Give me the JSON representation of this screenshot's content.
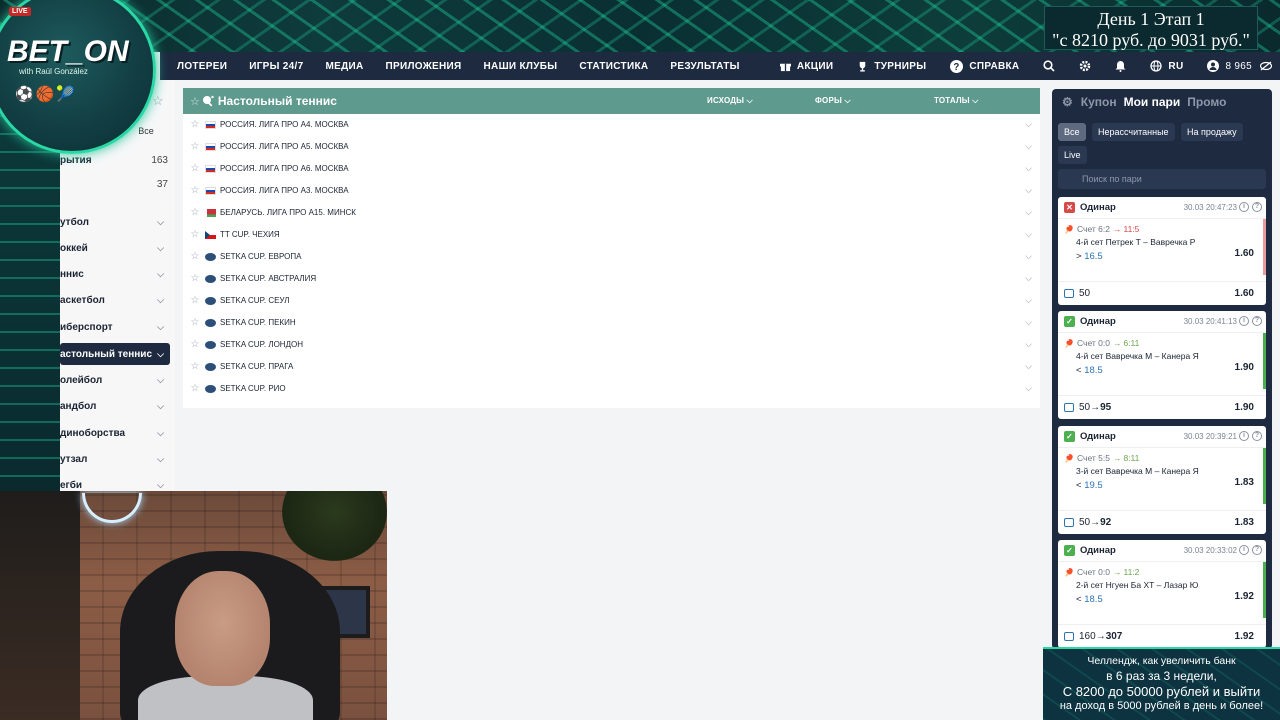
{
  "stream": {
    "stage_line1": "День 1  Этап 1",
    "stage_line2": "\"с 8210 руб. до 9031 руб.\"",
    "logo_live": "LIVE",
    "logo_brand": "BET_ON",
    "logo_sub": "with Raúl González"
  },
  "nav": {
    "items": [
      "ЛОТЕРЕИ",
      "ИГРЫ 24/7",
      "МЕДИА",
      "ПРИЛОЖЕНИЯ",
      "НАШИ КЛУБЫ",
      "СТАТИСТИКА",
      "РЕЗУЛЬТАТЫ"
    ],
    "promo": "АКЦИИ",
    "tournaments": "ТУРНИРЫ",
    "help": "СПРАВКА",
    "lang": "RU",
    "balance": "8 965"
  },
  "sidebar": {
    "all_label": "Все",
    "events_label": "рытия",
    "events_count": "163",
    "other_count": "37",
    "sports": [
      "утбол",
      "оккей",
      "ннис",
      "аскетбол",
      "иберспорт",
      "астольный теннис",
      "олейбол",
      "андбол",
      "диноборства",
      "утзал",
      "егби"
    ],
    "active_index": 5
  },
  "main": {
    "title": "Настольный теннис",
    "col_outcomes": "ИСХОДЫ",
    "col_handicaps": "ФОРЫ",
    "col_totals": "ТОТАЛЫ",
    "leagues": [
      {
        "name": "РОССИЯ. ЛИГА ПРО А4. МОСКВА",
        "flag": "ru"
      },
      {
        "name": "РОССИЯ. ЛИГА ПРО А5. МОСКВА",
        "flag": "ru"
      },
      {
        "name": "РОССИЯ. ЛИГА ПРО А6. МОСКВА",
        "flag": "ru"
      },
      {
        "name": "РОССИЯ. ЛИГА ПРО А3. МОСКВА",
        "flag": "ru"
      },
      {
        "name": "БЕЛАРУСЬ. ЛИГА ПРО А15. МИНСК",
        "flag": "by"
      },
      {
        "name": "TT CUP. ЧЕХИЯ",
        "flag": "cz"
      },
      {
        "name": "SETKA CUP. ЕВРОПА",
        "flag": "globe"
      },
      {
        "name": "SETKA CUP. АВСТРАЛИЯ",
        "flag": "globe"
      },
      {
        "name": "SETKA CUP. СЕУЛ",
        "flag": "globe"
      },
      {
        "name": "SETKA CUP. ПЕКИН",
        "flag": "globe"
      },
      {
        "name": "SETKA CUP. ЛОНДОН",
        "flag": "globe"
      },
      {
        "name": "SETKA CUP. ПРАГА",
        "flag": "globe"
      },
      {
        "name": "SETKA CUP. РИО",
        "flag": "globe"
      }
    ]
  },
  "coupon": {
    "tabs": [
      "Купон",
      "Мои пари",
      "Промо"
    ],
    "active_tab": 1,
    "filters": [
      "Все",
      "Нерассчитанные",
      "На продажу",
      "Live"
    ],
    "active_filter": 0,
    "search_placeholder": "Поиск по пари",
    "bets": [
      {
        "status": "lost",
        "type": "Одинар",
        "time": "30.03 20:47:23",
        "score": "Счет 6:2",
        "score_to": "11:5",
        "match": "4-й сет Петрек Т – Вавречка Р",
        "pick_op": ">",
        "pick_val": "16.5",
        "odds": "1.60",
        "stake": "50",
        "win": "",
        "total": "1.60"
      },
      {
        "status": "won",
        "type": "Одинар",
        "time": "30.03 20:41:13",
        "score": "Счет 0:0",
        "score_to": "6:11",
        "match": "4-й сет Вавречка М – Канера Я",
        "pick_op": "<",
        "pick_val": "18.5",
        "odds": "1.90",
        "stake": "50",
        "win": "95",
        "total": "1.90"
      },
      {
        "status": "won",
        "type": "Одинар",
        "time": "30.03 20:39:21",
        "score": "Счет 5:5",
        "score_to": "8:11",
        "match": "3-й сет Вавречка М – Канера Я",
        "pick_op": "<",
        "pick_val": "19.5",
        "odds": "1.83",
        "stake": "50",
        "win": "92",
        "total": "1.83"
      },
      {
        "status": "won",
        "type": "Одинар",
        "time": "30.03 20:33:02",
        "score": "Счет 0:0",
        "score_to": "11:2",
        "match": "2-й сет Нгуен Ба ХТ – Лазар Ю",
        "pick_op": "<",
        "pick_val": "18.5",
        "odds": "1.92",
        "stake": "160",
        "win": "307",
        "total": "1.92"
      }
    ]
  },
  "challenge": {
    "line1": "Челлендж, как увеличить банк",
    "line2": "в 6 раз за 3 недели,",
    "line3": "С 8200 до 50000 рублей и выйти",
    "line4": "на доход в 5000 рублей в день и более!"
  },
  "colors": {
    "nav_bg": "#1d2a40",
    "header_green": "#5e9a8e",
    "lost": "#d84a4a",
    "won": "#4caf50",
    "pick_blue": "#2e74b5"
  }
}
